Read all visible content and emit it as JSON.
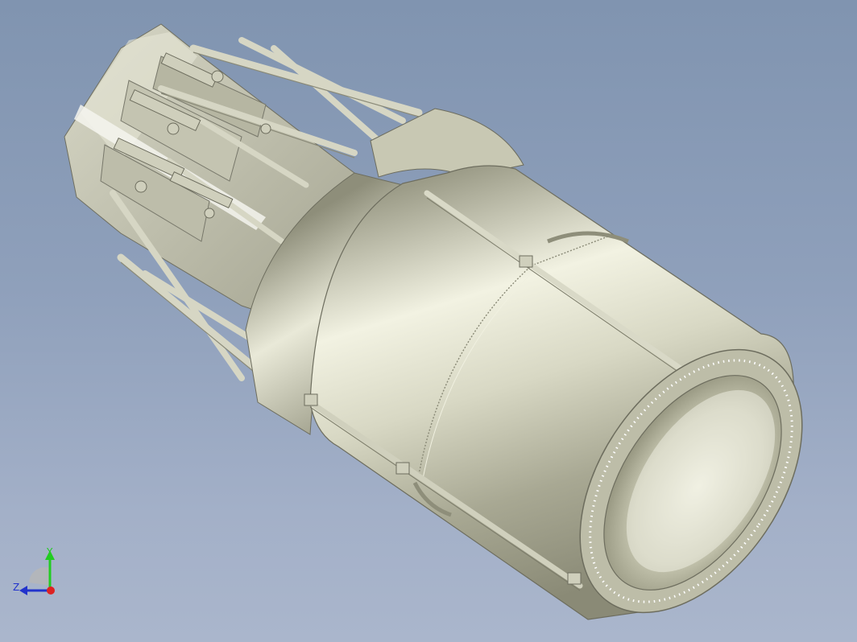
{
  "viewport": {
    "background_top": "#8094b0",
    "background_bottom": "#aab6cc",
    "model_color": "#c9c9b4"
  },
  "triad": {
    "y_label": "Y",
    "z_label": "Z",
    "y_color": "#22cc22",
    "z_color": "#2233cc",
    "x_color": "#dd2222"
  }
}
